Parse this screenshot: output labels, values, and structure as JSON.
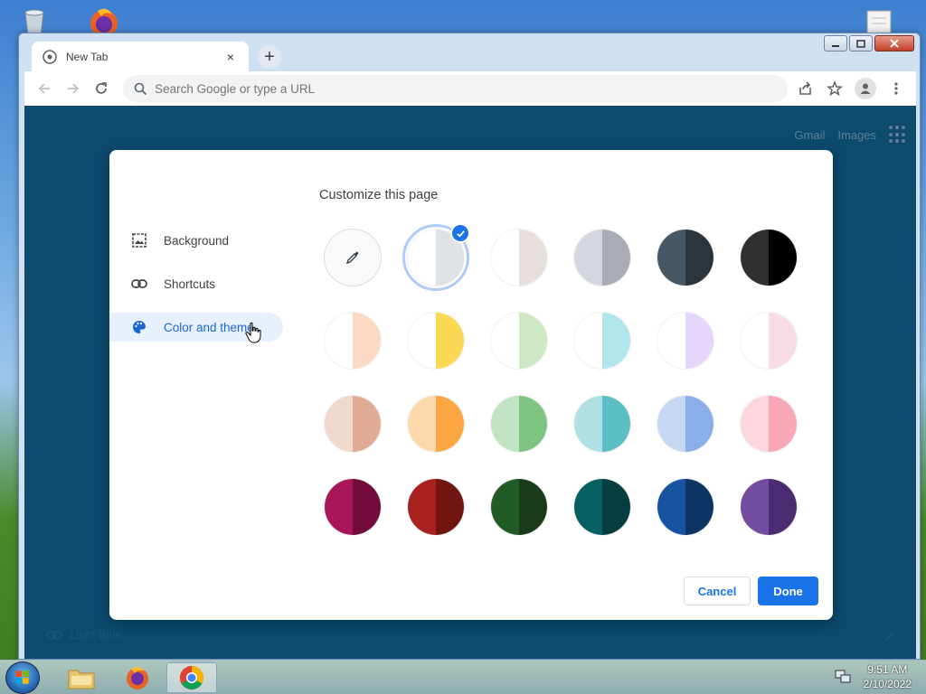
{
  "browser": {
    "tab_title": "New Tab",
    "tab_close": "×",
    "new_tab": "+",
    "omnibox_placeholder": "Search Google or type a URL"
  },
  "ntp": {
    "links": [
      "Gmail",
      "Images"
    ],
    "bottom_label": "Light Blue"
  },
  "dialog": {
    "title": "Customize this page",
    "sidebar": [
      {
        "label": "Background",
        "icon": "image-icon"
      },
      {
        "label": "Shortcuts",
        "icon": "link-icon"
      },
      {
        "label": "Color and theme",
        "icon": "palette-icon",
        "active": true
      }
    ],
    "swatches": [
      {
        "name": "custom",
        "left": "#f8f9fa",
        "right": "#f8f9fa"
      },
      {
        "name": "default",
        "left": "#ffffff",
        "right": "#dee1e6",
        "selected": true
      },
      {
        "name": "warm-grey",
        "left": "#ffffff",
        "right": "#e6dfdb"
      },
      {
        "name": "cool-grey",
        "left": "#d4d7de",
        "right": "#a9acb5"
      },
      {
        "name": "midnight-blue",
        "left": "#475763",
        "right": "#2c353c"
      },
      {
        "name": "black",
        "left": "#303030",
        "right": "#000000"
      },
      {
        "name": "beige-white",
        "left": "#ffffff",
        "right": "#fbdac4"
      },
      {
        "name": "yellow-white",
        "left": "#ffffff",
        "right": "#fcd954"
      },
      {
        "name": "green-white",
        "left": "#ffffff",
        "right": "#cde8c2"
      },
      {
        "name": "light-teal-white",
        "left": "#ffffff",
        "right": "#b2e6ef"
      },
      {
        "name": "light-purple-white",
        "left": "#ffffff",
        "right": "#e7d6fb"
      },
      {
        "name": "pink-white",
        "left": "#ffffff",
        "right": "#f9dbe5"
      },
      {
        "name": "beige",
        "left": "#f0d8cc",
        "right": "#e0ab95"
      },
      {
        "name": "orange",
        "left": "#fdd8ac",
        "right": "#fca641"
      },
      {
        "name": "light-green",
        "left": "#c2e4c3",
        "right": "#7dc580"
      },
      {
        "name": "light-teal",
        "left": "#b0e0e3",
        "right": "#5cbdc3"
      },
      {
        "name": "light-blue",
        "left": "#c6d8f4",
        "right": "#8aafe8"
      },
      {
        "name": "light-pink",
        "left": "#fdd5dc",
        "right": "#f9a7b6"
      },
      {
        "name": "dark-pink",
        "left": "#a8165a",
        "right": "#720c3a"
      },
      {
        "name": "dark-red",
        "left": "#a8211f",
        "right": "#711513"
      },
      {
        "name": "dark-green",
        "left": "#235b26",
        "right": "#183c1a"
      },
      {
        "name": "dark-teal",
        "left": "#065f60",
        "right": "#063d41"
      },
      {
        "name": "dark-blue",
        "left": "#1853a0",
        "right": "#0d3463"
      },
      {
        "name": "purple",
        "left": "#734b9f",
        "right": "#4b2b6f"
      }
    ],
    "cancel_label": "Cancel",
    "done_label": "Done"
  },
  "taskbar": {
    "time": "9:51 AM",
    "date": "2/10/2022"
  },
  "colors": {
    "accent": "#1a73e8",
    "ntp_background": "#0c4a6e"
  }
}
